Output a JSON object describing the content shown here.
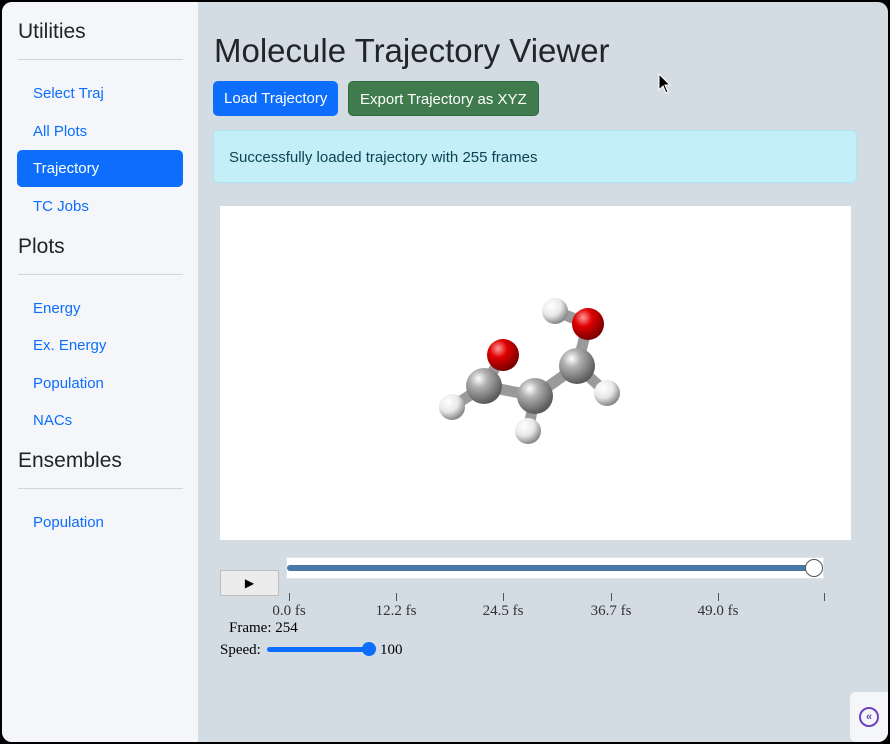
{
  "sidebar": {
    "sections": [
      {
        "heading": "Utilities",
        "items": [
          "Select Traj",
          "All Plots",
          "Trajectory",
          "TC Jobs"
        ]
      },
      {
        "heading": "Plots",
        "items": [
          "Energy",
          "Ex. Energy",
          "Population",
          "NACs"
        ]
      },
      {
        "heading": "Ensembles",
        "items": [
          "Population"
        ]
      }
    ],
    "active_item": "Trajectory"
  },
  "main": {
    "title": "Molecule Trajectory Viewer",
    "load_button": "Load Trajectory",
    "export_button": "Export Trajectory as XYZ",
    "alert_text": "Successfully loaded trajectory with 255 frames"
  },
  "player": {
    "play_label": "▶",
    "tick_labels": [
      "0.0 fs",
      "12.2 fs",
      "24.5 fs",
      "36.7 fs",
      "49.0 fs"
    ],
    "frame_text": "Frame: 254",
    "speed_label": "Speed:",
    "speed_value": "100",
    "progress_fraction": 1.0
  },
  "colors": {
    "primary": "#0d6efd",
    "success": "#3f7b4d",
    "alert_bg": "#c4eef8",
    "oxygen": "#e00000",
    "carbon": "#909090",
    "hydrogen": "#f0f0f0"
  },
  "icons": {
    "collapse": "double-chevron-left-icon",
    "play": "play-icon"
  }
}
